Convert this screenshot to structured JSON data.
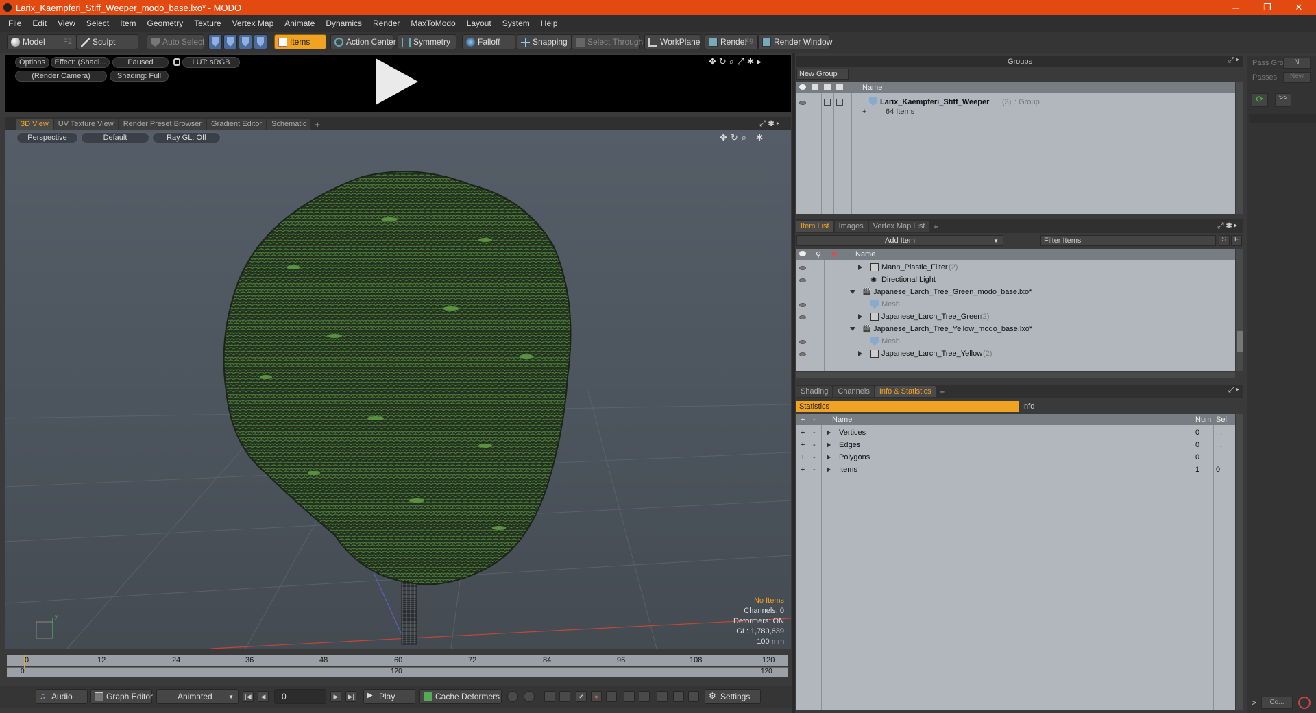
{
  "window": {
    "title": "Larix_Kaempferi_Stiff_Weeper_modo_base.lxo* - MODO",
    "min": "─",
    "max": "❐",
    "close": "✕"
  },
  "menu": [
    "File",
    "Edit",
    "View",
    "Select",
    "Item",
    "Geometry",
    "Texture",
    "Vertex Map",
    "Animate",
    "Dynamics",
    "Render",
    "MaxToModo",
    "Layout",
    "System",
    "Help"
  ],
  "toolbar": {
    "model": "Model",
    "model_key": "F2",
    "sculpt": "Sculpt",
    "auto_select": "Auto Select",
    "items": "Items",
    "action_center": "Action Center",
    "symmetry": "Symmetry",
    "falloff": "Falloff",
    "snapping": "Snapping",
    "select_through": "Select Through",
    "workplane": "WorkPlane",
    "render": "Render",
    "render_key": "F9",
    "render_window": "Render Window"
  },
  "preview": {
    "options": "Options",
    "effect": "Effect: (Shadi...",
    "paused": "Paused",
    "lut": "LUT: sRGB",
    "camera": "(Render Camera)",
    "shading": "Shading: Full"
  },
  "view_tabs": [
    "3D View",
    "UV Texture View",
    "Render Preset Browser",
    "Gradient Editor",
    "Schematic"
  ],
  "viewport": {
    "perspective": "Perspective",
    "default": "Default",
    "raygl": "Ray GL: Off",
    "info": [
      "No Items",
      "Channels: 0",
      "Deformers: ON",
      "GL: 1,780,639",
      "100 mm"
    ]
  },
  "timeline": {
    "ticks": [
      "0",
      "12",
      "24",
      "36",
      "48",
      "60",
      "72",
      "84",
      "96",
      "108",
      "120"
    ],
    "bottom": [
      "0",
      "120",
      "120"
    ]
  },
  "bottombar": {
    "audio": "Audio",
    "graph": "Graph Editor",
    "animated": "Animated",
    "frame": "0",
    "play": "Play",
    "cache": "Cache Deformers",
    "settings": "Settings"
  },
  "groups": {
    "title": "Groups",
    "new_group": "New Group",
    "col_name": "Name",
    "item_name": "Larix_Kaempferi_Stiff_Weeper",
    "item_count": "(3)",
    "item_type": ": Group",
    "item_sub": "64 Items"
  },
  "pass": {
    "pass_groups": "Pass Groups",
    "passes": "Passes",
    "new": "New",
    "n": "N",
    "more": ">>",
    "co": "Co...",
    "arrow": ">"
  },
  "itemlist": {
    "tabs": [
      "Item List",
      "Images",
      "Vertex Map List"
    ],
    "add_item": "Add Item",
    "filter": "Filter Items",
    "s": "S",
    "f": "F",
    "col_name": "Name",
    "rows": [
      {
        "label": "Mann_Plastic_Filter",
        "count": "(2)"
      },
      {
        "label": "Directional Light",
        "count": ""
      },
      {
        "label": "Japanese_Larch_Tree_Green_modo_base.lxo*",
        "count": ""
      },
      {
        "label": "Mesh",
        "count": ""
      },
      {
        "label": "Japanese_Larch_Tree_Green",
        "count": "(2)"
      },
      {
        "label": "Japanese_Larch_Tree_Yellow_modo_base.lxo*",
        "count": ""
      },
      {
        "label": "Mesh",
        "count": ""
      },
      {
        "label": "Japanese_Larch_Tree_Yellow",
        "count": "(2)"
      }
    ]
  },
  "stats": {
    "tabs": [
      "Shading",
      "Channels",
      "Info & Statistics"
    ],
    "statistics": "Statistics",
    "info": "Info",
    "col_name": "Name",
    "col_num": "Num",
    "col_sel": "Sel",
    "rows": [
      {
        "name": "Vertices",
        "num": "0",
        "sel": "..."
      },
      {
        "name": "Edges",
        "num": "0",
        "sel": "..."
      },
      {
        "name": "Polygons",
        "num": "0",
        "sel": "..."
      },
      {
        "name": "Items",
        "num": "1",
        "sel": "0"
      }
    ]
  }
}
